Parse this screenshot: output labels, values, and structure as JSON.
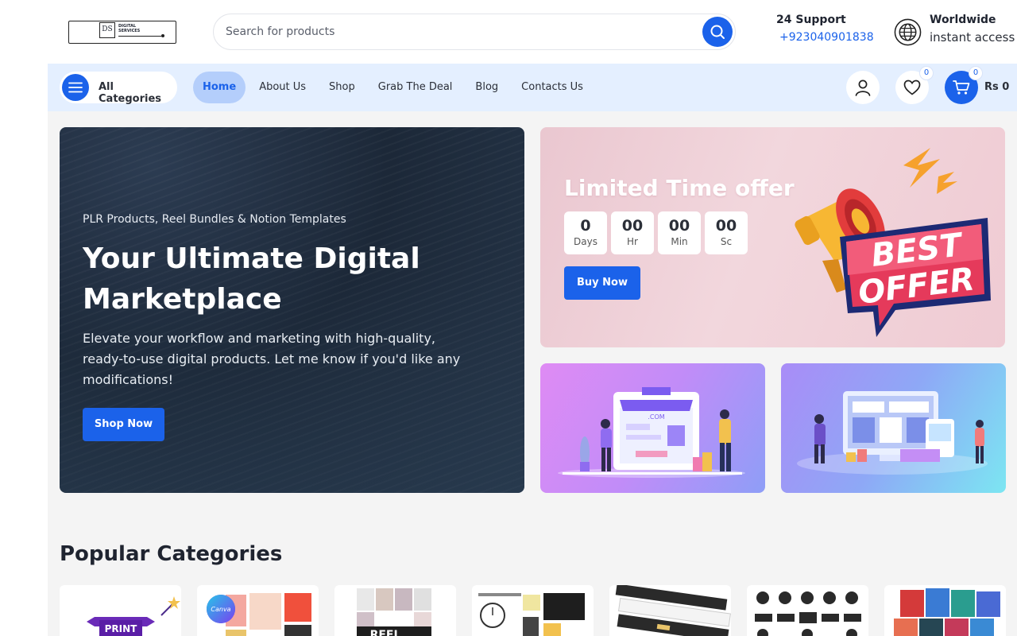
{
  "header": {
    "logo_text": "DIGITAL SERVICES",
    "search": {
      "placeholder": "Search for products"
    },
    "support": {
      "title": "24 Support",
      "phone": "+923040901838"
    },
    "worldwide": {
      "title": "Worldwide",
      "subtitle": "instant access"
    }
  },
  "nav": {
    "categories_label": "All Categories",
    "links": [
      {
        "label": "Home",
        "active": true
      },
      {
        "label": "About Us"
      },
      {
        "label": "Shop"
      },
      {
        "label": "Grab The Deal"
      },
      {
        "label": "Blog"
      },
      {
        "label": "Contacts Us"
      }
    ],
    "wishlist_count": "0",
    "cart_count": "0",
    "cart_total": "Rs 0"
  },
  "hero": {
    "subtitle": "PLR Products, Reel Bundles & Notion Templates",
    "title": "Your Ultimate Digital Marketplace",
    "description": "Elevate your workflow and marketing with high-quality, ready-to-use digital products. Let me know if you'd like any modifications!",
    "button": "Shop Now"
  },
  "offer": {
    "title": "Limited Time offer",
    "timer": [
      {
        "value": "0",
        "label": "Days"
      },
      {
        "value": "00",
        "label": "Hr"
      },
      {
        "value": "00",
        "label": "Min"
      },
      {
        "value": "00",
        "label": "Sc"
      }
    ],
    "button": "Buy Now",
    "badge_line1": "BEST",
    "badge_line2": "OFFER"
  },
  "promo1": {
    "text": ".COM"
  },
  "popular": {
    "title": "Popular Categories",
    "print_label": "PRINT",
    "canva_label": "Canva",
    "reels_label": "REEL"
  },
  "colors": {
    "accent": "#1b62ea",
    "nav_bg": "#e4efff",
    "main_bg": "#f4f4f4"
  }
}
